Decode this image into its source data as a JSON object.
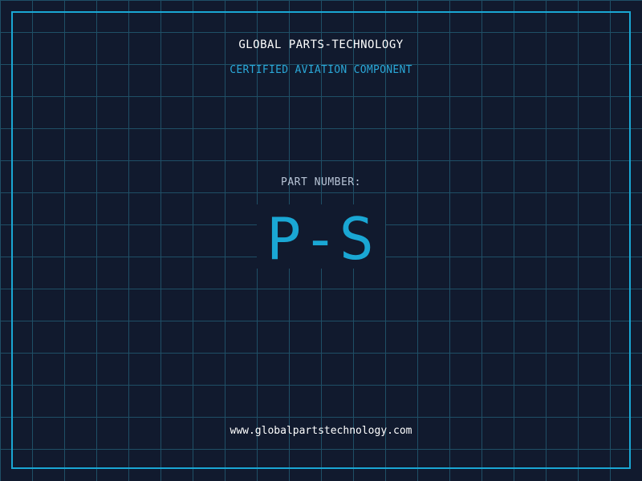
{
  "header": {
    "company_name": "GLOBAL PARTS-TECHNOLOGY",
    "subtitle": "CERTIFIED AVIATION COMPONENT"
  },
  "part": {
    "label": "PART NUMBER:",
    "number": "P-S"
  },
  "footer": {
    "website": "www.globalpartstechnology.com"
  },
  "colors": {
    "background": "#111a2e",
    "grid": "#1f4f66",
    "accent": "#1aa7d4",
    "text_primary": "#ffffff",
    "text_secondary": "#b8c4d6"
  }
}
